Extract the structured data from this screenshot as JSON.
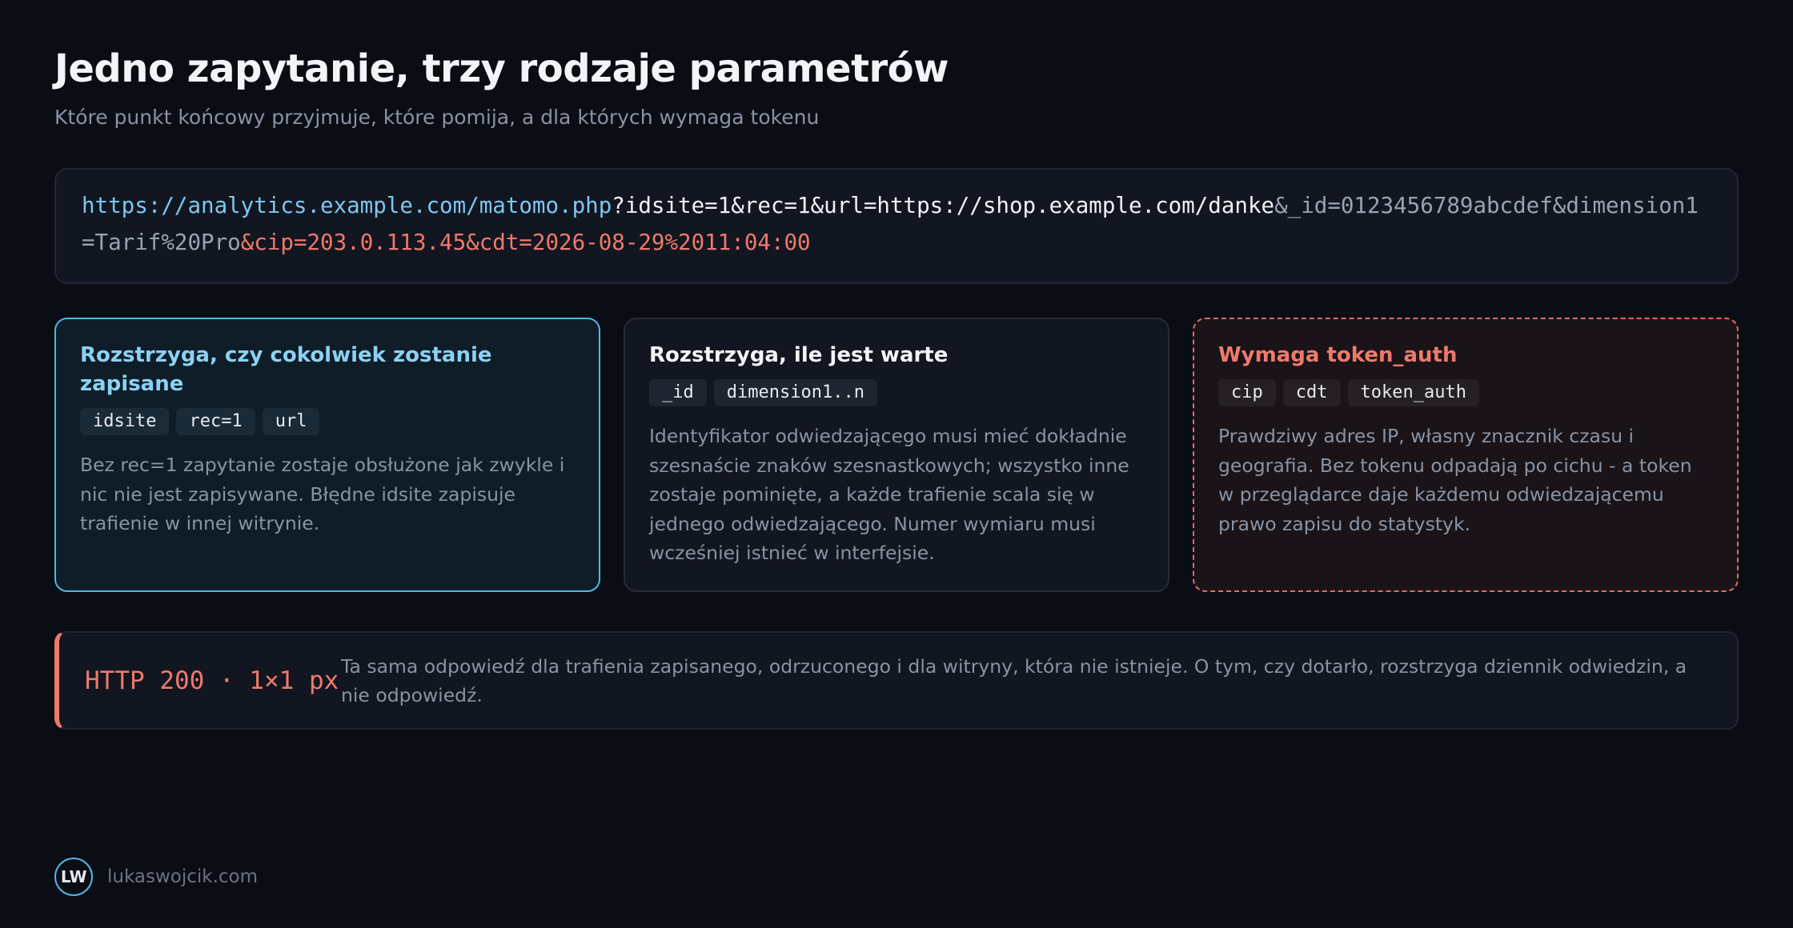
{
  "header": {
    "title": "Jedno zapytanie, trzy rodzaje parametrów",
    "subtitle": "Które punkt końcowy przyjmuje, które pomija, a dla których wymaga tokenu"
  },
  "url": {
    "base": "https://analytics.example.com/matomo.php",
    "core_params": "?idsite=1&rec=1&url=https://shop.example.com/danke",
    "value_params": "&_id=0123456789abcdef&dimension1=Tarif%20Pro",
    "token_params": "&cip=203.0.113.45&cdt=2026-08-29%2011:04:00"
  },
  "cards": [
    {
      "title": "Rozstrzyga, czy cokolwiek zostanie zapisane",
      "chips": [
        "idsite",
        "rec=1",
        "url"
      ],
      "text": "Bez rec=1 zapytanie zostaje obsłużone jak zwykle i nic nie jest zapisywane. Błędne idsite zapisuje trafienie w innej witrynie."
    },
    {
      "title": "Rozstrzyga, ile jest warte",
      "chips": [
        "_id",
        "dimension1..n"
      ],
      "text": "Identyfikator odwiedzającego musi mieć dokładnie szesnaście znaków szesnastkowych; wszystko inne zostaje pominięte, a każde trafienie scala się w jednego odwiedzającego. Numer wymiaru musi wcześniej istnieć w interfejsie."
    },
    {
      "title": "Wymaga token_auth",
      "chips": [
        "cip",
        "cdt",
        "token_auth"
      ],
      "text": "Prawdziwy adres IP, własny znacznik czasu i geografia. Bez tokenu odpadają po cichu - a token w przeglądarce daje każdemu odwiedzającemu prawo zapisu do statystyk."
    }
  ],
  "banner": {
    "label": "HTTP 200 · 1×1 px",
    "text": "Ta sama odpowiedź dla trafienia zapisanego, odrzuconego i dla witryny, która nie istnieje. O tym, czy dotarło, rozstrzyga dziennik odwiedzin, a nie odpowiedź."
  },
  "footer": {
    "logo": "LW",
    "site": "lukaswojcik.com"
  },
  "colors": {
    "background": "#0a0d14",
    "accent_blue": "#4fb8e6",
    "accent_red": "#ee7a6b",
    "muted_text": "#8a93a3"
  }
}
